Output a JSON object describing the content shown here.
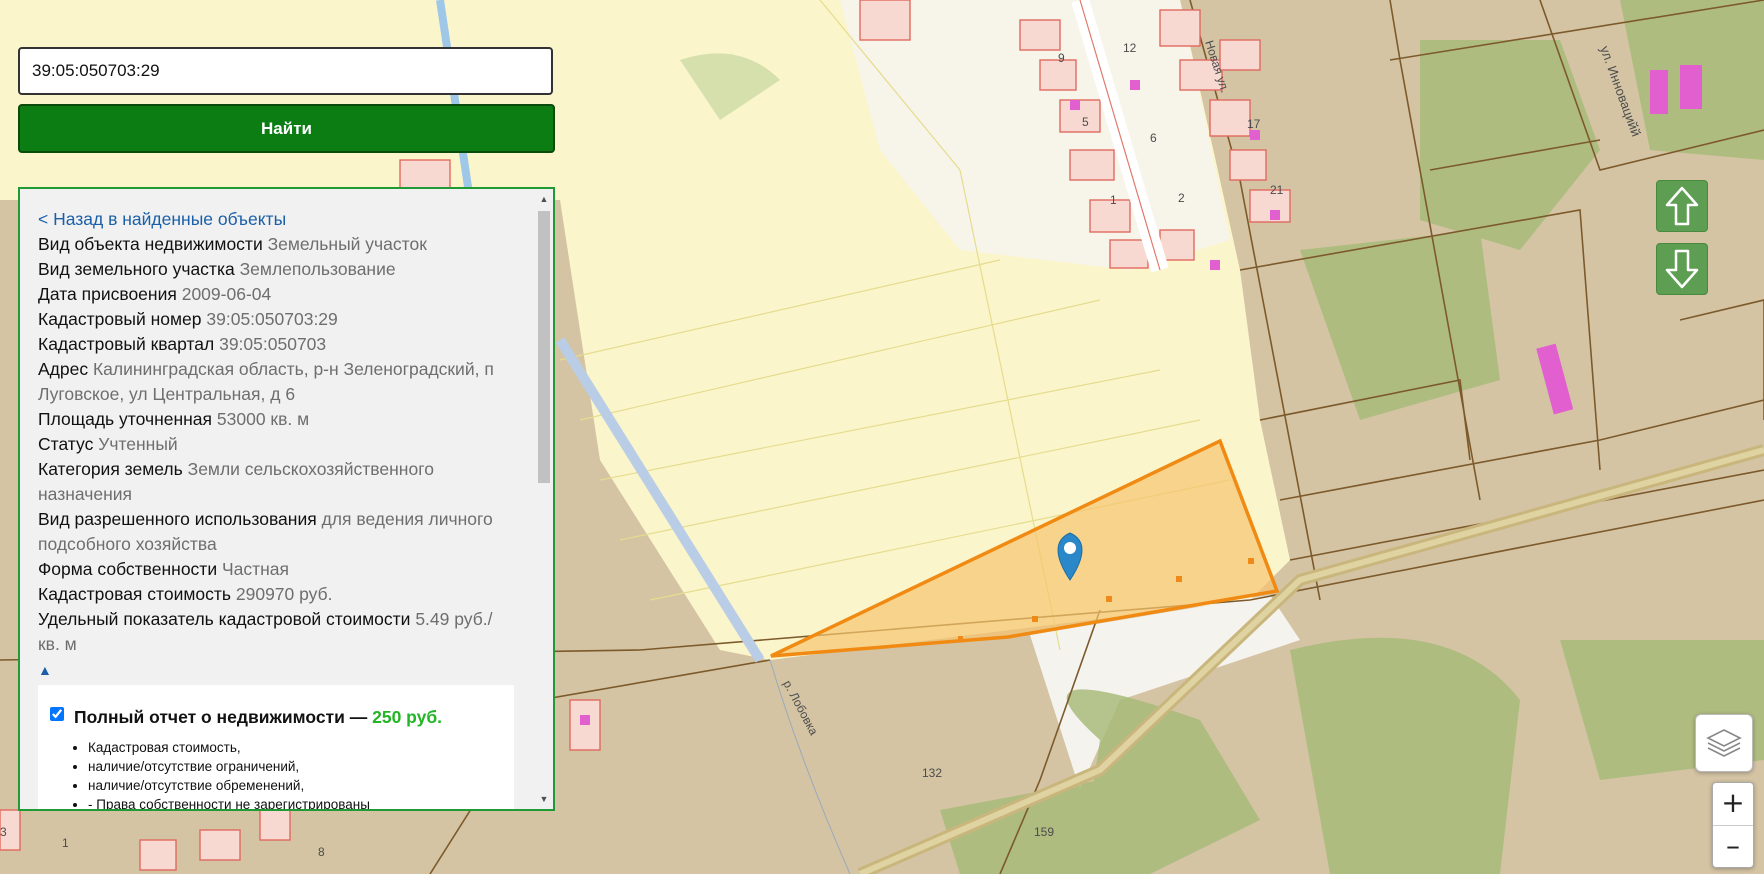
{
  "search": {
    "value": "39:05:050703:29",
    "button_label": "Найти"
  },
  "panel": {
    "back_link": "< Назад в найденные объекты",
    "rows": [
      {
        "label": "Вид объекта недвижимости",
        "value": "Земельный участок"
      },
      {
        "label": "Вид земельного участка",
        "value": "Землепользование"
      },
      {
        "label": "Дата присвоения",
        "value": "2009-06-04"
      },
      {
        "label": "Кадастровый номер",
        "value": "39:05:050703:29"
      },
      {
        "label": "Кадастровый квартал",
        "value": "39:05:050703"
      },
      {
        "label": "Адрес",
        "value": "Калининградская область, р-н Зеленоградский, п Луговское, ул Центральная, д 6"
      },
      {
        "label": "Площадь уточненная",
        "value": "53000 кв. м"
      },
      {
        "label": "Статус",
        "value": "Учтенный"
      },
      {
        "label": "Категория земель",
        "value": "Земли сельскохозяйственного назначения"
      },
      {
        "label": "Вид разрешенного использования",
        "value": "для ведения личного подсобного хозяйства"
      },
      {
        "label": "Форма собственности",
        "value": "Частная"
      },
      {
        "label": "Кадастровая стоимость",
        "value": "290970 руб."
      },
      {
        "label": "Удельный показатель кадастровой стоимости",
        "value": "5.49 руб./ кв. м"
      }
    ],
    "collapse_icon": "triangle-up",
    "report": {
      "checked": true,
      "title": "Полный отчет о недвижимости — ",
      "price": "250 руб.",
      "items": [
        "Кадастровая стоимость,",
        "наличие/отсутствие ограничений,",
        "наличие/отсутствие обременений,",
        "- Права собственности не зарегистрированы"
      ]
    }
  },
  "map": {
    "streets": [
      "Новая ул.",
      "ул. Инновацийй",
      "р. Лобовка"
    ],
    "house_numbers": [
      "12",
      "9",
      "5",
      "17",
      "1",
      "2",
      "21",
      "6",
      "132",
      "159",
      "1",
      "8",
      "3"
    ],
    "parcel_color": "#f7c56f",
    "parcel_stroke": "#f08a12"
  },
  "controls": {
    "up_icon": "arrow-up-icon",
    "down_icon": "arrow-down-icon",
    "layers_icon": "layers-icon",
    "zoom_in": "+",
    "zoom_out": "–"
  }
}
